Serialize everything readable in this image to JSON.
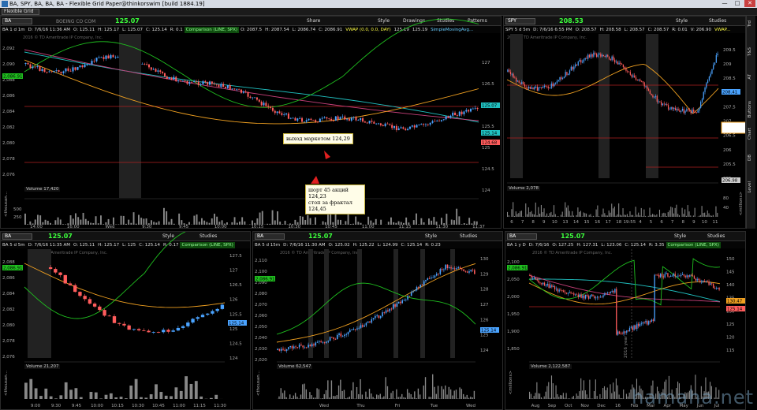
{
  "window": {
    "title": "BA, SPY, BA, BA, BA - Flexible Grid Paper@thinkorswim [build 1884.19]",
    "min": "—",
    "max": "□",
    "close": "✕"
  },
  "toolbar": {
    "grid_select": "Flexible Grid"
  },
  "colors": {
    "up": "#4aa3ff",
    "down": "#ff5c5c",
    "green": "#1fbf1f",
    "ma_orange": "#f0a020",
    "ma_pink": "#c8407a",
    "cyan": "#20c0c0",
    "red_line": "#b02020"
  },
  "main_chart": {
    "symbol": "BA",
    "info": [
      "BA 1 d 1m",
      "D: 7/6/16 11:36 AM",
      "O: 125.11",
      "H: 125.17",
      "L: 125.07",
      "C: 125.14",
      "R: 0.1",
      "Comparison (LINE, SPX)",
      "O: 2087.5",
      "H: 2087.54",
      "L: 2086.74",
      "C: 2086.91",
      "VWAP (0.0, 0.0, DAY)",
      "125.19",
      "125.19",
      "SimpleMovingAvg..."
    ],
    "faded_ticker": "BOEING CO COM",
    "price": "125.07",
    "buttons": {
      "share": "Share",
      "style": "Style",
      "drawings": "Drawings",
      "studies": "Studies",
      "patterns": "Patterns"
    },
    "copyright": "2016 © TD Ameritrade IP Company, Inc.",
    "left_axis": [
      "2,092",
      "2,090",
      "2,088",
      "2,086",
      "2,084",
      "2,082",
      "2,080",
      "2,078",
      "2,076"
    ],
    "right_axis": [
      "127",
      "126.5",
      "126",
      "125.5",
      "125",
      "124.5",
      "124"
    ],
    "right_tags": [
      {
        "text": "125.07",
        "color": "#20c0c0"
      },
      {
        "text": "125.14",
        "color": "#20c0c0"
      },
      {
        "text": "124.68",
        "color": "#ff5c5c"
      }
    ],
    "left_tag": "2,086.91",
    "time_axis": [
      "14:00",
      "16:00",
      "Wed",
      "9:30",
      "9:45",
      "10:00",
      "10:15",
      "10:30",
      "10:45",
      "11:00",
      "11:15",
      "11:30",
      "11:37"
    ],
    "volume_label": "Volume",
    "volume_value": "17,420",
    "vol_axis": [
      "500",
      "250"
    ],
    "vol_unit": "<thousan...",
    "callout1": "выход маркетом 124,29",
    "callout2": [
      "шорт 45 акций 124,23",
      "стоп за фрактал",
      "124,45"
    ]
  },
  "spy_chart": {
    "symbol": "SPY",
    "price": "208.53",
    "info": [
      "SPY 5 d 5m",
      "D: 7/6/16 6:55 PM",
      "O: 208.57",
      "H: 208.58",
      "L: 208.57",
      "C: 208.57",
      "R: 0.01",
      "V: 206.90",
      "VWAP..."
    ],
    "buttons": {
      "style": "Style",
      "studies": "Studies"
    },
    "copyright": "2016 © TD Ameritrade IP Company, Inc.",
    "right_axis": [
      "209.5",
      "209",
      "208.5",
      "208",
      "207.5",
      "207",
      "206.5",
      "206",
      "205.5",
      "205"
    ],
    "right_tags": [
      {
        "text": "208.41",
        "color": "#4aa3ff"
      },
      {
        "text": "206.98",
        "color": "#ccc"
      }
    ],
    "time_axis": [
      "6",
      "7",
      "8",
      "9",
      "10",
      "13",
      "14",
      "15",
      "16",
      "17",
      "18",
      "19:55",
      "4",
      "5",
      "6",
      "7",
      "8",
      "9",
      "10",
      "11"
    ],
    "volume_label": "Volume",
    "volume_value": "2,078",
    "vol_unit": "<millions>",
    "vol_axis": [
      "80",
      "40"
    ]
  },
  "side_tabs": [
    "Trd",
    "T&S",
    "AT",
    "Buttons",
    "Chart",
    "DB",
    "Level"
  ],
  "bl_chart": {
    "symbol": "BA",
    "price": "125.07",
    "info": [
      "BA 5 d 5m",
      "D: 7/6/16 11:35 AM",
      "O: 125.11",
      "H: 125.17",
      "L: 125",
      "C: 125.14",
      "R: 0.17",
      "Comparison (LINE, SPX)"
    ],
    "copyright": "2016 © TD Ameritrade IP Company, Inc.",
    "left_axis": [
      "2,088",
      "2,086",
      "2,084",
      "2,082",
      "2,080",
      "2,078",
      "2,076"
    ],
    "right_axis": [
      "127.5",
      "127",
      "126.5",
      "126",
      "125.5",
      "125",
      "124.5",
      "124"
    ],
    "left_tag": "2,086.91",
    "right_tag": "125.14",
    "time_axis": [
      "9:00",
      "9:30",
      "9:45",
      "10:00",
      "10:15",
      "10:30",
      "10:45",
      "11:00",
      "11:15",
      "11:30"
    ],
    "volume_label": "Volume",
    "volume_value": "21,207",
    "vol_unit": "<thousan...",
    "buttons": {
      "style": "Style",
      "studies": "Studies"
    }
  },
  "bm_chart": {
    "symbol": "BA",
    "price": "125.07",
    "info": [
      "BA 5 d 15m",
      "D: 7/6/16 11:30 AM",
      "O: 125.02",
      "H: 125.22",
      "L: 124.99",
      "C: 125.14",
      "R: 0.23"
    ],
    "copyright": "2016 © TD Ameritrade IP Company, Inc.",
    "left_axis": [
      "2,110",
      "2,100",
      "2,090",
      "2,080",
      "2,070",
      "2,060",
      "2,050",
      "2,040",
      "2,030",
      "2,020"
    ],
    "right_axis": [
      "130",
      "129",
      "128",
      "127",
      "126",
      "125",
      "124"
    ],
    "left_tag": "2,086.91",
    "right_tag": "125.14",
    "time_axis": [
      "Wed",
      "Thu",
      "Fri",
      "Tue",
      "Wed"
    ],
    "volume_label": "Volume",
    "volume_value": "62,547",
    "vol_unit": "<thousan...",
    "buttons": {
      "style": "Style",
      "studies": "Studies"
    }
  },
  "br_chart": {
    "symbol": "BA",
    "price": "125.07",
    "info": [
      "BA 1 y D",
      "D: 7/6/16",
      "O: 127.25",
      "H: 127.31",
      "L: 123.06",
      "C: 125.14",
      "R: 3.35",
      "Comparison (LINE, SPX)"
    ],
    "copyright": "2016 © TD Ameritrade IP Company, Inc.",
    "left_axis": [
      "2,100",
      "2,050",
      "2,000",
      "1,950",
      "1,900",
      "1,850"
    ],
    "right_axis": [
      "150",
      "145",
      "140",
      "135",
      "130",
      "125",
      "120",
      "115"
    ],
    "left_tag": "2,086.91",
    "right_tags": [
      {
        "text": "130.47",
        "color": "#f0a020"
      },
      {
        "text": "125.14",
        "color": "#ff5c5c"
      }
    ],
    "year_label": "2016 year",
    "time_axis": [
      "Aug",
      "Sep",
      "Oct",
      "Nov",
      "Dec",
      "16",
      "Feb",
      "Mar",
      "Apr",
      "May",
      "Jun",
      "Jul"
    ],
    "volume_label": "Volume",
    "volume_value": "2,122,587",
    "vol_unit": "<millions>",
    "buttons": {
      "style": "Style",
      "studies": "Studies"
    }
  },
  "watermark": "hamaha.net"
}
